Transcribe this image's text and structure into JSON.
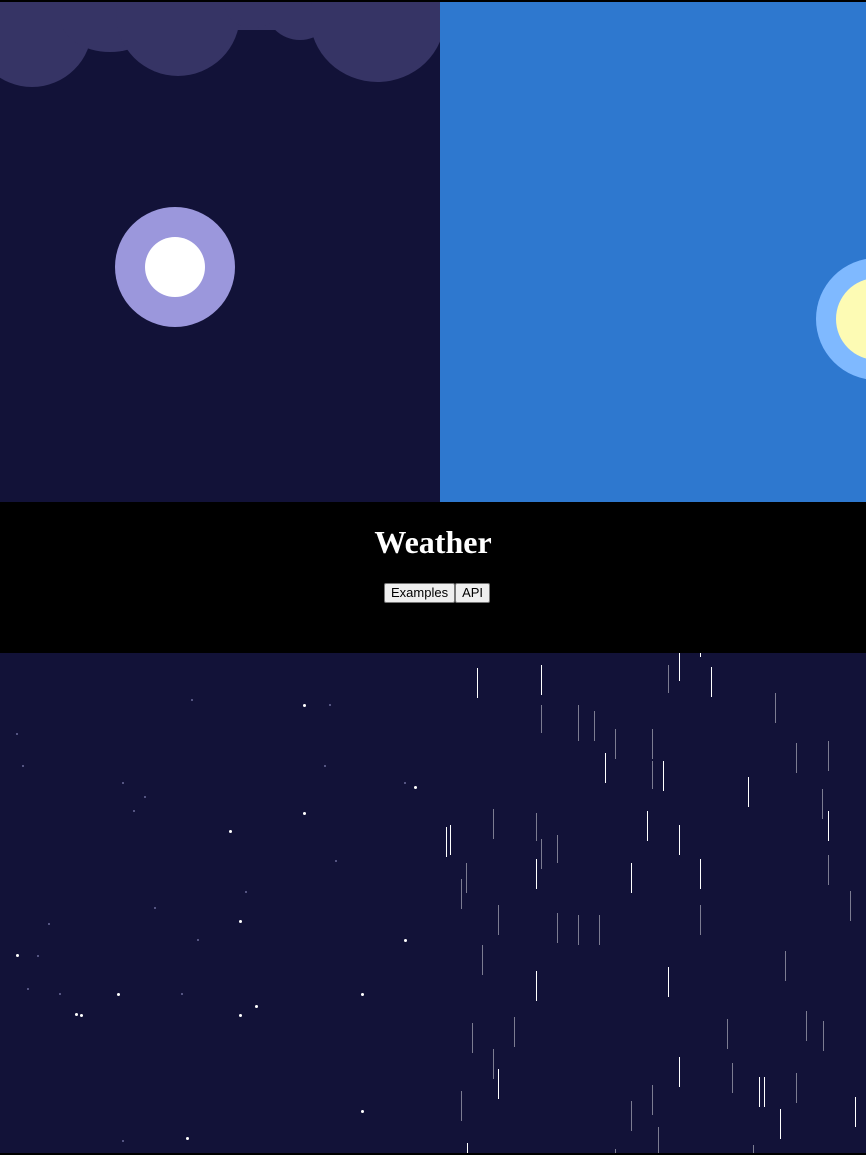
{
  "header": {
    "title": "Weather",
    "buttons": [
      {
        "label": "Examples"
      },
      {
        "label": "API"
      }
    ]
  },
  "scenes": {
    "cloudy_night": {
      "icons": [
        "cloud-icon",
        "moon-icon"
      ],
      "colors": {
        "sky": "#121238",
        "cloud": "#363465",
        "moon_halo": "#9b97dc",
        "moon": "#ffffff"
      }
    },
    "clear_day": {
      "icons": [
        "sun-icon"
      ],
      "colors": {
        "sky": "#2e78cf",
        "sun_halo": "#7fb9ff",
        "sun": "#fdfbb4"
      }
    },
    "starry_night": {
      "icons": [
        "star-icon"
      ],
      "colors": {
        "sky": "#121238",
        "star_bright": "#ffffff",
        "star_dim": "#6a6a99"
      }
    },
    "rain": {
      "icons": [
        "raindrop-icon"
      ],
      "colors": {
        "sky": "#121238",
        "rain": "#ffffff"
      }
    }
  }
}
